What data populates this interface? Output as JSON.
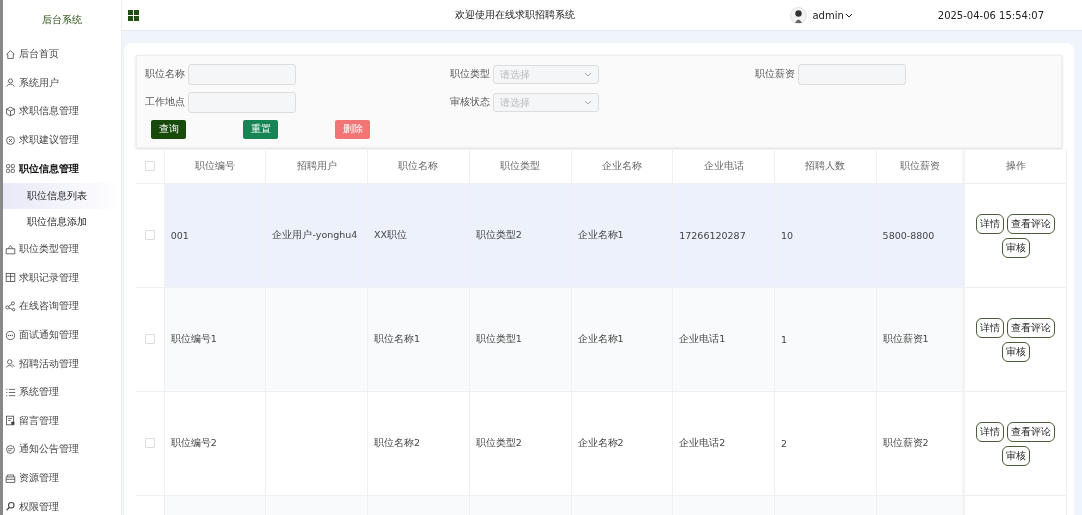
{
  "sidebar": {
    "title": "后台系统",
    "items": [
      {
        "label": "后台首页",
        "selected": false
      },
      {
        "label": "系统用户",
        "selected": false
      },
      {
        "label": "求职信息管理",
        "selected": false
      },
      {
        "label": "求职建议管理",
        "selected": false
      },
      {
        "label": "职位信息管理",
        "selected": false,
        "expanded": true,
        "children": [
          {
            "label": "职位信息列表",
            "selected": true
          },
          {
            "label": "职位信息添加",
            "selected": false
          }
        ]
      },
      {
        "label": "职位类型管理",
        "selected": false
      },
      {
        "label": "求职记录管理",
        "selected": false
      },
      {
        "label": "在线咨询管理",
        "selected": false
      },
      {
        "label": "面试通知管理",
        "selected": false
      },
      {
        "label": "招聘活动管理",
        "selected": false
      },
      {
        "label": "系统管理",
        "selected": false
      },
      {
        "label": "留言管理",
        "selected": false
      },
      {
        "label": "通知公告管理",
        "selected": false
      },
      {
        "label": "资源管理",
        "selected": false
      },
      {
        "label": "权限管理",
        "selected": false
      }
    ]
  },
  "header": {
    "title": "欢迎使用在线求职招聘系统",
    "user": "admin",
    "datetime": "2025-04-06 15:54:07"
  },
  "filters": [
    [
      {
        "label": "职位名称",
        "kind": "input"
      },
      {
        "label": "职位类型",
        "kind": "select",
        "placeholder": "请选择"
      },
      {
        "label": "职位薪资",
        "kind": "input"
      }
    ],
    [
      {
        "label": "工作地点",
        "kind": "input"
      },
      {
        "label": "审核状态",
        "kind": "select",
        "placeholder": "请选择"
      }
    ]
  ],
  "buttons": [
    {
      "label": "查询",
      "kind": "primary"
    },
    {
      "label": "重置",
      "kind": "success"
    },
    {
      "label": "删除",
      "kind": "danger"
    }
  ],
  "table": {
    "all_checked": false,
    "columns": [
      "职位编号",
      "招聘用户",
      "职位名称",
      "职位类型",
      "企业名称",
      "企业电话",
      "招聘人数",
      "职位薪资",
      "操作"
    ],
    "rows": [
      {
        "checked": false,
        "selected": true,
        "cells": [
          "001",
          "企业用户-yonghu4",
          "XX职位",
          "职位类型2",
          "企业名称1",
          "17266120287",
          "10",
          "5800-8800"
        ],
        "actions": [
          "详情",
          "查看评论",
          "审核"
        ]
      },
      {
        "checked": false,
        "selected": false,
        "cells": [
          "职位编号1",
          "",
          "职位名称1",
          "职位类型1",
          "企业名称1",
          "企业电话1",
          "1",
          "职位薪资1"
        ],
        "actions": [
          "详情",
          "查看评论",
          "审核"
        ]
      },
      {
        "checked": false,
        "selected": false,
        "cells": [
          "职位编号2",
          "",
          "职位名称2",
          "职位类型2",
          "企业名称2",
          "企业电话2",
          "2",
          "职位薪资2"
        ],
        "actions": [
          "详情",
          "查看评论",
          "审核"
        ]
      }
    ]
  }
}
